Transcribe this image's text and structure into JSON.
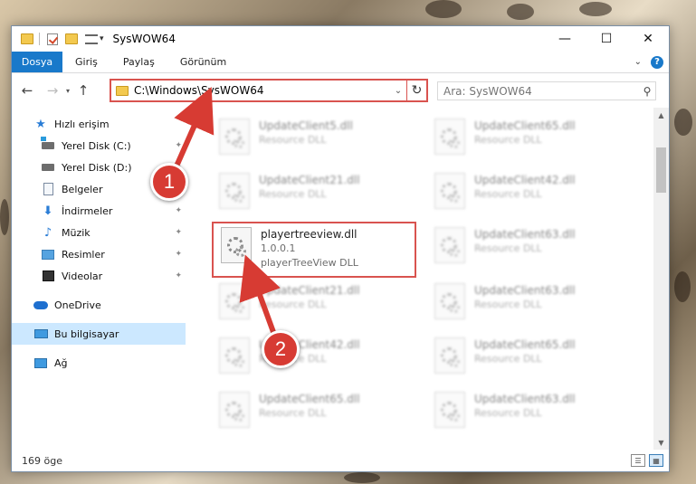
{
  "window": {
    "title": "SysWOW64",
    "controls": {
      "minimize": "—",
      "maximize": "☐",
      "close": "✕"
    }
  },
  "ribbon": {
    "tabs": [
      "Dosya",
      "Giriş",
      "Paylaş",
      "Görünüm"
    ],
    "help": "?"
  },
  "address": {
    "path": "C:\\Windows\\SysWOW64",
    "search_placeholder": "Ara: SysWOW64"
  },
  "nav": {
    "quick_access": "Hızlı erişim",
    "items": [
      {
        "label": "Yerel Disk (C:)",
        "icon": "drive-icon"
      },
      {
        "label": "Yerel Disk (D:)",
        "icon": "drive-icon"
      },
      {
        "label": "Belgeler",
        "icon": "documents-icon"
      },
      {
        "label": "İndirmeler",
        "icon": "downloads-icon"
      },
      {
        "label": "Müzik",
        "icon": "music-icon"
      },
      {
        "label": "Resimler",
        "icon": "pictures-icon"
      },
      {
        "label": "Videolar",
        "icon": "videos-icon"
      }
    ],
    "onedrive": "OneDrive",
    "this_pc": "Bu bilgisayar",
    "network": "Ağ"
  },
  "files": [
    {
      "name": "UpdateClient5.dll",
      "sub": "Resource DLL"
    },
    {
      "name": "UpdateClient65.dll",
      "sub": "Resource DLL"
    },
    {
      "name": "UpdateClient21.dll",
      "sub": "Resource DLL"
    },
    {
      "name": "UpdateClient42.dll",
      "sub": "Resource DLL"
    },
    {
      "name": "playertreeview.dll",
      "version": "1.0.0.1",
      "sub": "playerTreeView DLL"
    },
    {
      "name": "UpdateClient63.dll",
      "sub": "Resource DLL"
    },
    {
      "name": "UpdateClient21.dll",
      "sub": "Resource DLL"
    },
    {
      "name": "UpdateClient63.dll",
      "sub": "Resource DLL"
    },
    {
      "name": "UpdateClient42.dll",
      "sub": "Resource DLL"
    },
    {
      "name": "UpdateClient65.dll",
      "sub": "Resource DLL"
    },
    {
      "name": "UpdateClient65.dll",
      "sub": "Resource DLL"
    },
    {
      "name": "UpdateClient63.dll",
      "sub": "Resource DLL"
    }
  ],
  "status": {
    "count": "169 öge"
  },
  "annotations": {
    "step1": "1",
    "step2": "2"
  },
  "colors": {
    "accent": "#1979ca",
    "highlight": "#d9534f",
    "badge": "#d73b33",
    "selected": "#cce8ff"
  }
}
